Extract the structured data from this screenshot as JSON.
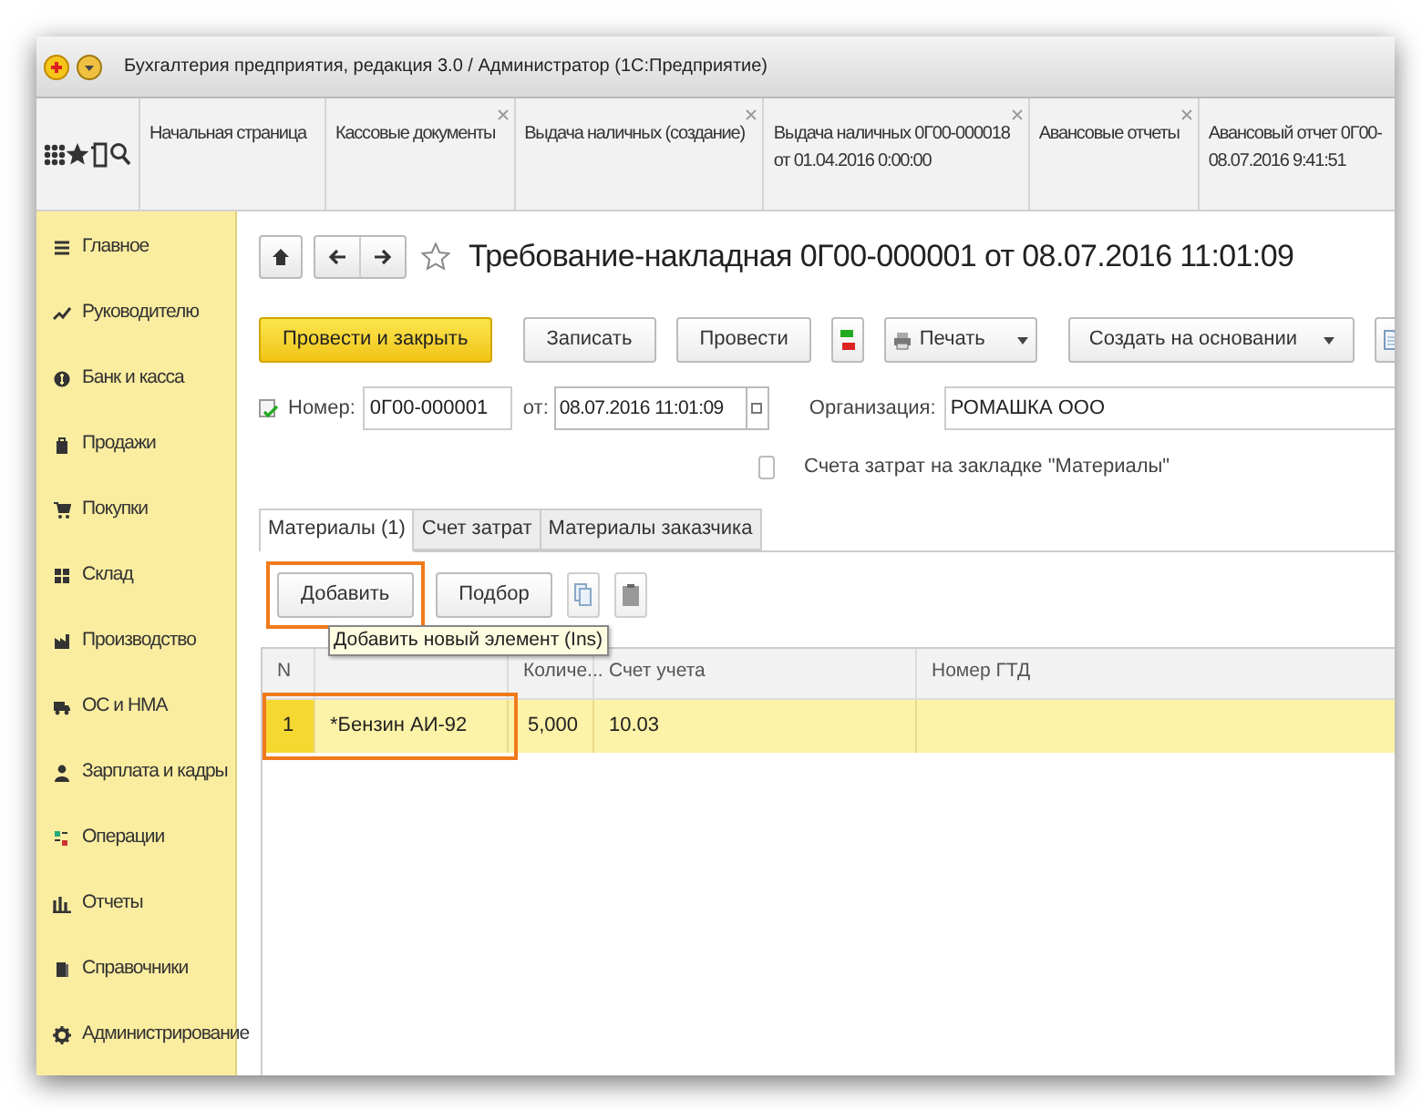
{
  "window": {
    "title": "Бухгалтерия предприятия, редакция 3.0 / Администратор  (1С:Предприятие)"
  },
  "open_tabs": [
    {
      "lines": [
        "Начальная страница"
      ],
      "closable": false
    },
    {
      "lines": [
        "Кассовые документы"
      ],
      "closable": true
    },
    {
      "lines": [
        "Выдача наличных (создание)"
      ],
      "closable": true
    },
    {
      "lines": [
        "Выдача наличных 0Г00-000018",
        "от 01.04.2016 0:00:00"
      ],
      "closable": true
    },
    {
      "lines": [
        "Авансовые отчеты"
      ],
      "closable": true
    },
    {
      "lines": [
        "Авансовый отчет 0Г00-",
        "08.07.2016 9:41:51"
      ],
      "closable": false
    }
  ],
  "sidebar": {
    "items": [
      {
        "label": "Главное"
      },
      {
        "label": "Руководителю"
      },
      {
        "label": "Банк и касса"
      },
      {
        "label": "Продажи"
      },
      {
        "label": "Покупки"
      },
      {
        "label": "Склад"
      },
      {
        "label": "Производство"
      },
      {
        "label": "ОС и НМА"
      },
      {
        "label": "Зарплата и кадры"
      },
      {
        "label": "Операции"
      },
      {
        "label": "Отчеты"
      },
      {
        "label": "Справочники"
      },
      {
        "label": "Администрирование"
      }
    ]
  },
  "form": {
    "title": "Требование-накладная 0Г00-000001 от 08.07.2016 11:01:09",
    "toolbar": [
      {
        "kind": "primary",
        "label": "Провести и закрыть"
      },
      {
        "kind": "plain",
        "label": "Записать"
      },
      {
        "kind": "plain",
        "label": "Провести"
      },
      {
        "kind": "dtkt"
      },
      {
        "kind": "print",
        "label": "Печать"
      },
      {
        "kind": "dropdown",
        "label": "Создать на основании"
      },
      {
        "kind": "doc"
      }
    ],
    "number_label": "Номер:",
    "number": "0Г00-000001",
    "date_label": "от:",
    "date": "08.07.2016 11:01:09",
    "org_label": "Организация:",
    "org": "РОМАШКА ООО",
    "cost_checkbox": {
      "label": "Счета затрат на закладке \"Материалы\"",
      "checked": false
    },
    "tabs": [
      {
        "label": "Материалы (1)",
        "selected": true
      },
      {
        "label": "Счет затрат",
        "selected": false
      },
      {
        "label": "Материалы заказчика",
        "selected": false
      }
    ],
    "table_toolbar": [
      {
        "kind": "plain",
        "label": "Добавить",
        "highlighted": true
      },
      {
        "kind": "plain",
        "label": "Подбор",
        "highlighted": false
      },
      {
        "kind": "copy"
      },
      {
        "kind": "paste"
      }
    ],
    "tooltip": "Добавить новый элемент (Ins)",
    "table": {
      "columns": [
        "N",
        "",
        "Количе...",
        "Счет учета",
        "Номер ГТД"
      ],
      "rows": [
        {
          "selected": true,
          "highlighted": true,
          "cells": [
            "1",
            "*Бензин АИ-92",
            "5,000",
            "10.03",
            ""
          ]
        }
      ]
    }
  }
}
